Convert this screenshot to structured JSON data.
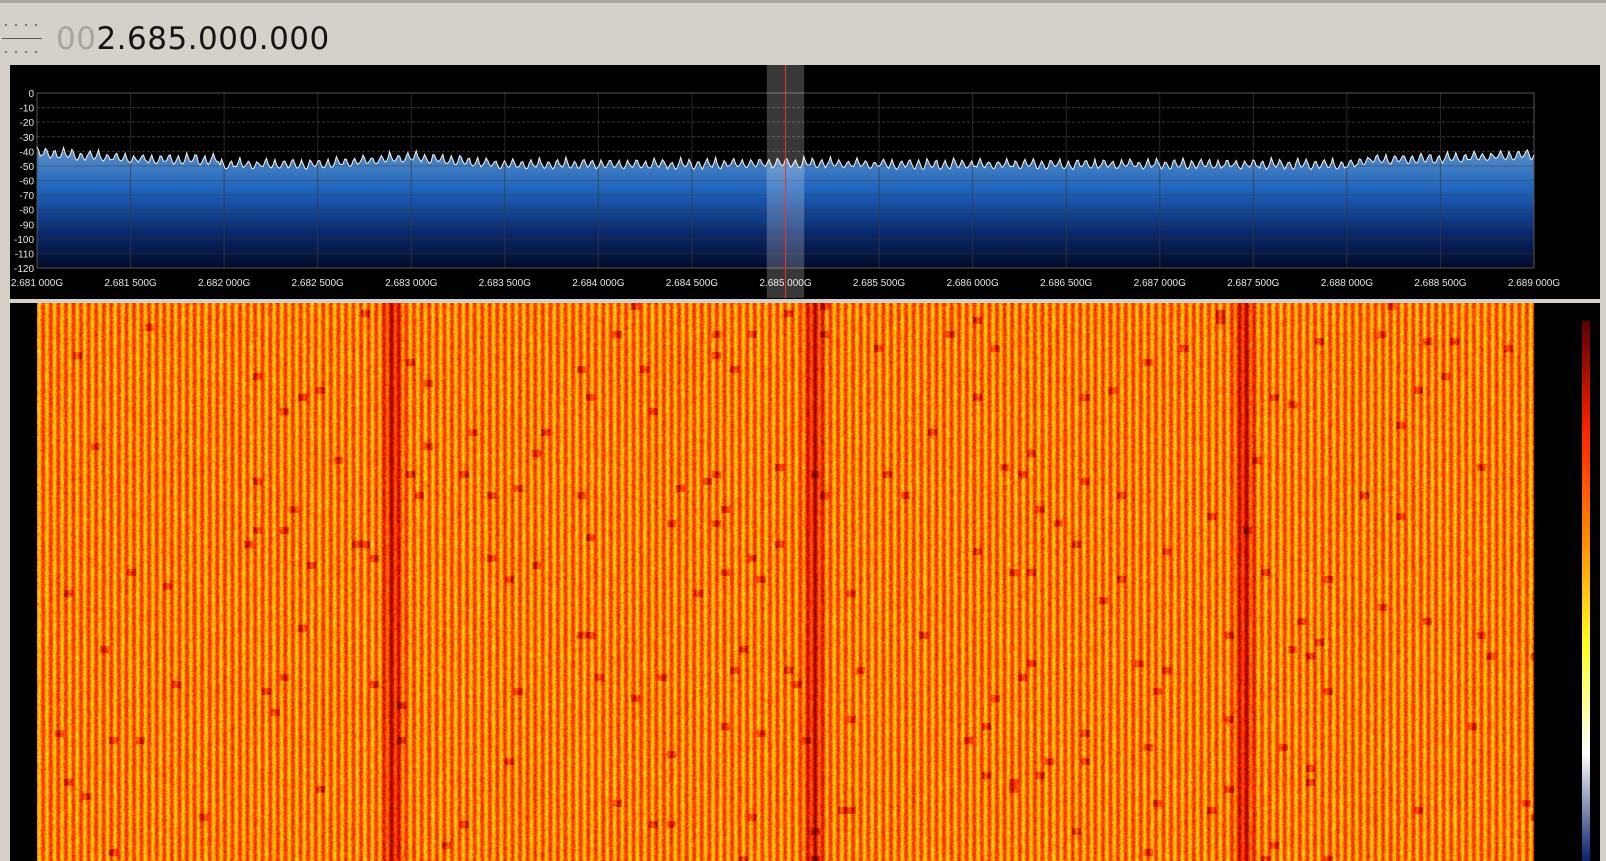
{
  "app": {
    "frequency_display": {
      "leading_zeros": "00",
      "value": "2.685.000.000"
    }
  },
  "fft_plot": {
    "type": "line",
    "y_ticks": [
      "0",
      "-10",
      "-20",
      "-30",
      "-40",
      "-50",
      "-60",
      "-70",
      "-80",
      "-90",
      "-100",
      "-110",
      "-120"
    ],
    "x_ticks": [
      "2.681 000G",
      "2.681 500G",
      "2.682 000G",
      "2.682 500G",
      "2.683 000G",
      "2.683 500G",
      "2.684 000G",
      "2.684 500G",
      "2.685 000G",
      "2.685 500G",
      "2.686 000G",
      "2.686 500G",
      "2.687 000G",
      "2.687 500G",
      "2.688 000G",
      "2.688 500G",
      "2.689 000G"
    ],
    "x_range_hz": [
      2681000000,
      2689000000
    ],
    "y_range_db": [
      -120,
      0
    ],
    "grid": true,
    "center_frequency_hz": 2685000000,
    "filter_band_hz": [
      2684900000,
      2685100000
    ],
    "noise_floor_db": -47,
    "ripple_db": 8,
    "colors": {
      "trace": "#f3f3f3",
      "fill_top": "#5d92c7",
      "fill_bottom": "#020a28",
      "marker": "#ff2a2a",
      "grid": "#3a3a3a",
      "labels": "#e6e6e6"
    }
  },
  "waterfall": {
    "colormap": [
      "#08206a",
      "#ffffff",
      "#ffff20",
      "#ff8800",
      "#ff2000",
      "#5a0000"
    ],
    "base_color": "#ff5218",
    "hot_bands_hz": [
      2682900000,
      2685150000,
      2687450000
    ]
  },
  "chart_data": {
    "type": "line",
    "title": "",
    "xlabel": "",
    "ylabel": "",
    "x_range_hz": [
      2681000000,
      2689000000
    ],
    "ylim": [
      -120,
      0
    ],
    "series": [
      {
        "x_hz": [
          2681000000,
          2681500000,
          2682000000,
          2682500000,
          2683000000,
          2683500000,
          2684000000,
          2684500000,
          2685000000,
          2685500000,
          2686000000,
          2686500000,
          2687000000,
          2687500000,
          2688000000,
          2688500000,
          2689000000
        ],
        "values_db": [
          -43,
          -47,
          -48,
          -48,
          -43,
          -48,
          -48,
          -48,
          -47,
          -48,
          -48,
          -48,
          -48,
          -48,
          -48,
          -47,
          -44
        ]
      }
    ]
  }
}
